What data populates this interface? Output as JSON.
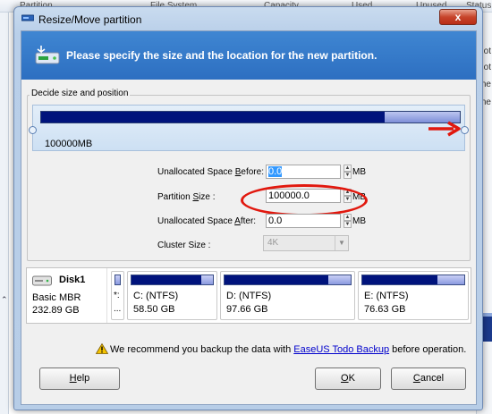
{
  "background": {
    "columns": [
      "Partition",
      "File System",
      "Capacity",
      "Used",
      "Unused",
      "Status"
    ],
    "right_texts": [
      "ot",
      "ot",
      "ne",
      "ne"
    ]
  },
  "dialog": {
    "title": "Resize/Move partition",
    "close_label": "x",
    "banner_text": "Please specify the size and the location for the new partition.",
    "group_label": "Decide size and position",
    "partition_bar_label": "100000MB",
    "fields": {
      "unallocated_before": {
        "label_pre": "Unallocated Space ",
        "label_u": "B",
        "label_post": "efore:",
        "value": "0.0",
        "unit": "MB"
      },
      "partition_size": {
        "label_pre": "Partition ",
        "label_u": "S",
        "label_post": "ize :",
        "value": "100000.0",
        "unit": "MB"
      },
      "unallocated_after": {
        "label_pre": "Unallocated Space ",
        "label_u": "A",
        "label_post": "fter:",
        "value": "0.0",
        "unit": "MB"
      },
      "cluster_size": {
        "label": "Cluster Size :",
        "value": "4K"
      }
    },
    "disk": {
      "name": "Disk1",
      "type": "Basic MBR",
      "size": "232.89 GB",
      "unalloc_name": "*:",
      "unalloc_size": "...",
      "partitions": [
        {
          "name": "C: (NTFS)",
          "size": "58.50 GB",
          "used_fraction": 0.86
        },
        {
          "name": "D: (NTFS)",
          "size": "97.66 GB",
          "used_fraction": 0.82
        },
        {
          "name": "E: (NTFS)",
          "size": "76.63 GB",
          "used_fraction": 0.74
        }
      ]
    },
    "warning": {
      "before": "We recommend you backup the data with ",
      "link": "EaseUS Todo Backup",
      "after": " before operation."
    },
    "buttons": {
      "help_u": "H",
      "help_rest": "elp",
      "ok_u": "O",
      "ok_rest": "K",
      "cancel_u": "C",
      "cancel_rest": "ancel"
    }
  },
  "colors": {
    "banner": "#3f86d2",
    "partition_used": "#00137c",
    "annotation_red": "#e1180e"
  }
}
